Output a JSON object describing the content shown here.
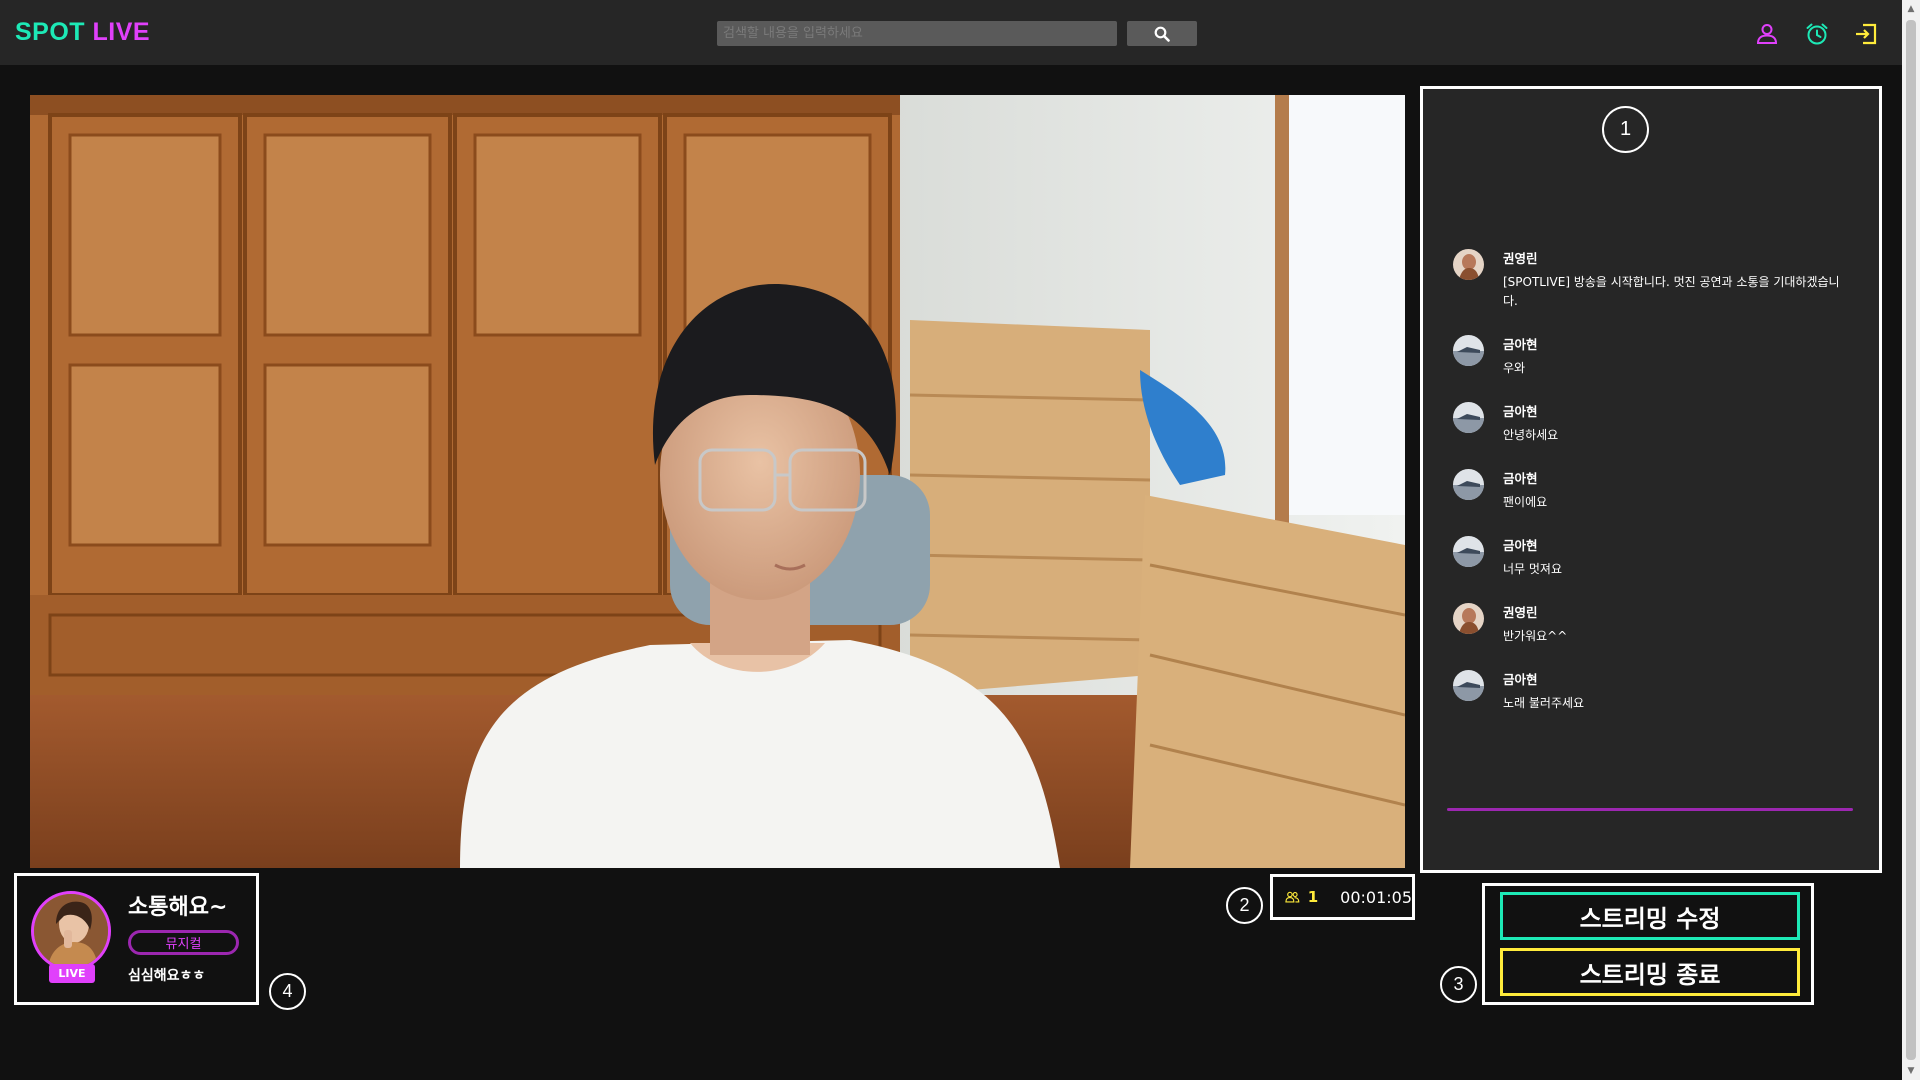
{
  "header": {
    "logo_part1": "SPOT",
    "logo_part2": "LIVE",
    "search_placeholder": "검색할 내용을 입력하세요",
    "icons": [
      "user-icon",
      "alarm-clock-icon",
      "logout-icon"
    ]
  },
  "markers": {
    "chat": "1",
    "viewers": "2",
    "buttons": "3",
    "profile": "4"
  },
  "chat": {
    "messages": [
      {
        "name": "권영린",
        "text": "[SPOTLIVE] 방송을 시작합니다. 멋진 공연과 소통을 기대하겠습니다.",
        "avatar": "avatar-a"
      },
      {
        "name": "금아현",
        "text": "우와",
        "avatar": "avatar-b"
      },
      {
        "name": "금아현",
        "text": "안녕하세요",
        "avatar": "avatar-b"
      },
      {
        "name": "금아현",
        "text": "팬이에요",
        "avatar": "avatar-b"
      },
      {
        "name": "금아현",
        "text": "너무 멋져요",
        "avatar": "avatar-b"
      },
      {
        "name": "권영린",
        "text": "반가워요^^",
        "avatar": "avatar-a"
      },
      {
        "name": "금아현",
        "text": "노래 불러주세요",
        "avatar": "avatar-b"
      }
    ]
  },
  "stream": {
    "viewer_count": "1",
    "elapsed": "00:01:05",
    "edit_label": "스트리밍 수정",
    "end_label": "스트리밍 종료"
  },
  "profile": {
    "title": "소통해요~",
    "category": "뮤지컬",
    "description": "심심해요ㅎㅎ",
    "live_badge": "LIVE"
  },
  "colors": {
    "teal": "#1de9b6",
    "magenta": "#e040fb",
    "yellow": "#ffeb3b",
    "purple": "#9c27b0",
    "header_bg": "#262626",
    "page_bg": "#111111"
  }
}
